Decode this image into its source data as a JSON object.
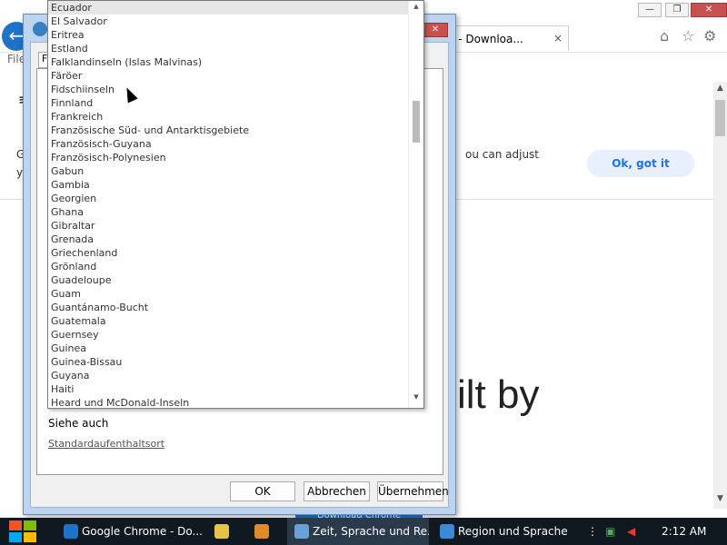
{
  "browser": {
    "tab_title": "e - Downloa...",
    "tab_close": "×",
    "menubar_stub": "File",
    "hamburger_icon": "≡",
    "cookie_text_right": "ou can adjust",
    "cookie_left_1": "G",
    "cookie_left_2": "y",
    "ok_got_it": "Ok, got it",
    "hero_text": "ilt by",
    "download_btn": "Download Chrome",
    "win_min": "—",
    "win_max": "❐",
    "win_close": "✕",
    "home_icon": "⌂",
    "star_icon": "☆",
    "gear_icon": "⚙"
  },
  "dialog": {
    "close": "✕",
    "tab_stub": "F",
    "dropdown_items": [
      "Ecuador",
      "El Salvador",
      "Eritrea",
      "Estland",
      "Falklandinseln (Islas Malvinas)",
      "Färöer",
      "Fidschiinseln",
      "Finnland",
      "Frankreich",
      "Französische Süd- und Antarktisgebiete",
      "Französisch-Guyana",
      "Französisch-Polynesien",
      "Gabun",
      "Gambia",
      "Georgien",
      "Ghana",
      "Gibraltar",
      "Grenada",
      "Griechenland",
      "Grönland",
      "Guadeloupe",
      "Guam",
      "Guantánamo-Bucht",
      "Guatemala",
      "Guernsey",
      "Guinea",
      "Guinea-Bissau",
      "Guyana",
      "Haiti",
      "Heard und McDonald-Inseln"
    ],
    "selected_item": "Ecuador",
    "siehe_auch": "Siehe auch",
    "standard_link": "Standardaufenthaltsort",
    "buttons": {
      "ok": "OK",
      "cancel": "Abbrechen",
      "apply": "Übernehmen"
    }
  },
  "taskbar": {
    "tasks": [
      {
        "label": "Google Chrome - Do...",
        "active": false
      },
      {
        "label": "",
        "active": false
      },
      {
        "label": "",
        "active": false
      },
      {
        "label": "Zeit, Sprache und Re...",
        "active": true
      },
      {
        "label": "Region und Sprache",
        "active": false
      }
    ],
    "tray_more": "⋮",
    "clock": "2:12 AM"
  },
  "colors": {
    "accent": "#1a73e8",
    "dialog_frame": "#bcd4ef",
    "taskbar_bg": "#101820",
    "close_red": "#c75050"
  }
}
